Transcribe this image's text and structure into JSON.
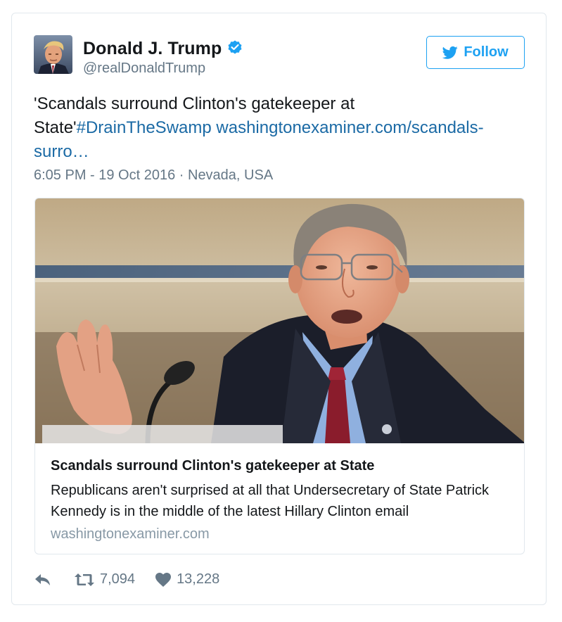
{
  "user": {
    "name": "Donald J. Trump",
    "handle": "@realDonaldTrump",
    "verified": true
  },
  "follow_button": {
    "label": "Follow",
    "icon": "twitter-bird-icon",
    "color": "#1da1f2"
  },
  "tweet": {
    "text_plain": "'Scandals surround Clinton's gatekeeper at State'",
    "hashtag": "#DrainTheSwamp",
    "link_text": "washingtonexaminer.com/scandals-surro…",
    "link_color": "#1b6aa5",
    "timestamp": "6:05 PM - 19 Oct 2016 · Nevada, USA"
  },
  "card": {
    "title": "Scandals surround Clinton's gatekeeper at State",
    "description": "Republicans aren't surprised at all that Undersecretary of State Patrick Kennedy is in the middle of the latest Hillary Clinton email",
    "domain": "washingtonexaminer.com"
  },
  "actions": {
    "reply_icon": "reply-icon",
    "retweet_icon": "retweet-icon",
    "retweet_count": "7,094",
    "like_icon": "heart-icon",
    "like_count": "13,228"
  }
}
